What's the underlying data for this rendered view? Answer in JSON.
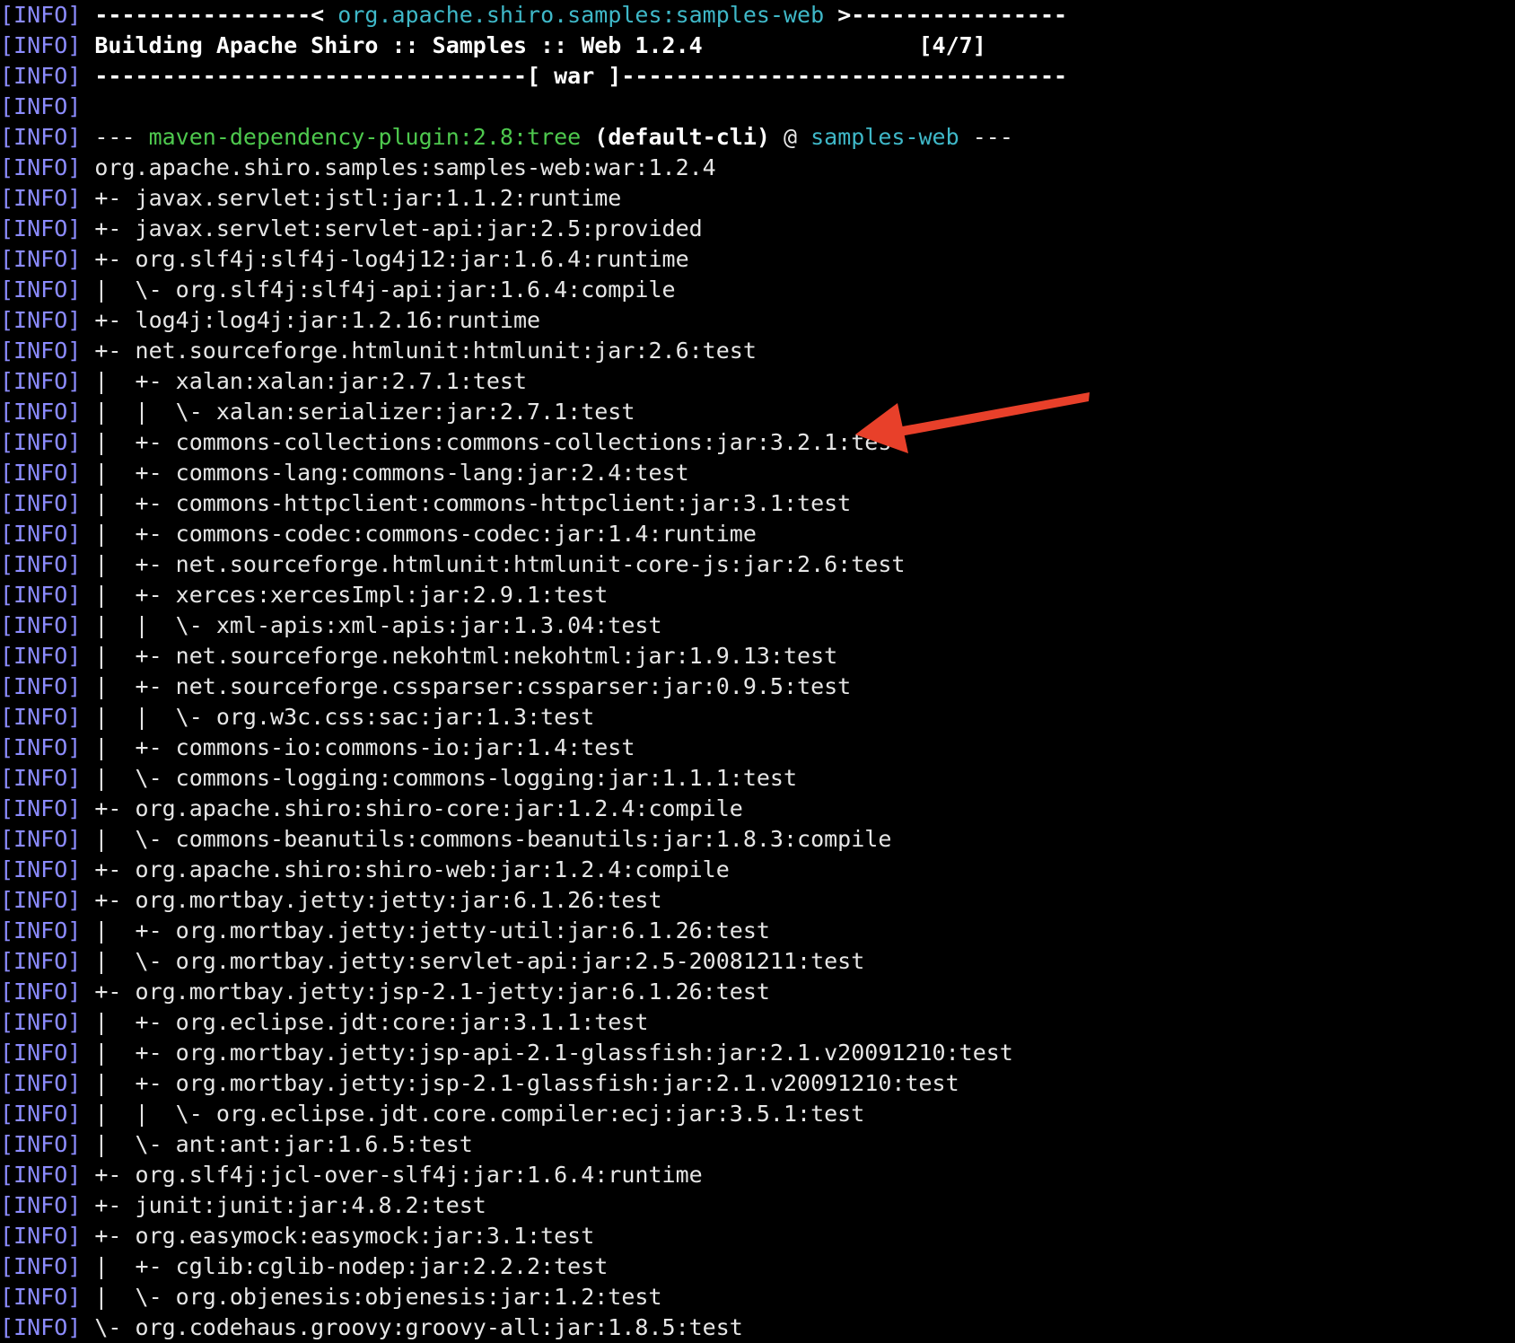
{
  "colors": {
    "background": "#000000",
    "text": "#e6e6e6",
    "info_tag": "#8c8cff",
    "green": "#4ec94e",
    "cyan": "#3fb8c8",
    "arrow": "#e8402a"
  },
  "icons": {
    "annotation": "red-arrow-icon"
  },
  "lines": [
    [
      {
        "t": "[INFO]",
        "c": "tag"
      },
      {
        "t": " ----------------< ",
        "c": "bold"
      },
      {
        "t": "org.apache.shiro.samples:samples-web",
        "c": "cyan"
      },
      {
        "t": " >----------------",
        "c": "bold"
      }
    ],
    [
      {
        "t": "[INFO]",
        "c": "tag"
      },
      {
        "t": " Building Apache Shiro :: Samples :: Web 1.2.4                [4/7]",
        "c": "bold"
      }
    ],
    [
      {
        "t": "[INFO]",
        "c": "tag"
      },
      {
        "t": " --------------------------------[ war ]---------------------------------",
        "c": "bold"
      }
    ],
    [
      {
        "t": "[INFO]",
        "c": "tag"
      }
    ],
    [
      {
        "t": "[INFO]",
        "c": "tag"
      },
      {
        "t": " --- "
      },
      {
        "t": "maven-dependency-plugin:2.8:tree",
        "c": "green"
      },
      {
        "t": " (default-cli)",
        "c": "bold"
      },
      {
        "t": " @ "
      },
      {
        "t": "samples-web",
        "c": "cyan"
      },
      {
        "t": " ---"
      }
    ],
    [
      {
        "t": "[INFO]",
        "c": "tag"
      },
      {
        "t": " org.apache.shiro.samples:samples-web:war:1.2.4"
      }
    ],
    [
      {
        "t": "[INFO]",
        "c": "tag"
      },
      {
        "t": " +- javax.servlet:jstl:jar:1.1.2:runtime"
      }
    ],
    [
      {
        "t": "[INFO]",
        "c": "tag"
      },
      {
        "t": " +- javax.servlet:servlet-api:jar:2.5:provided"
      }
    ],
    [
      {
        "t": "[INFO]",
        "c": "tag"
      },
      {
        "t": " +- org.slf4j:slf4j-log4j12:jar:1.6.4:runtime"
      }
    ],
    [
      {
        "t": "[INFO]",
        "c": "tag"
      },
      {
        "t": " |  \\- org.slf4j:slf4j-api:jar:1.6.4:compile"
      }
    ],
    [
      {
        "t": "[INFO]",
        "c": "tag"
      },
      {
        "t": " +- log4j:log4j:jar:1.2.16:runtime"
      }
    ],
    [
      {
        "t": "[INFO]",
        "c": "tag"
      },
      {
        "t": " +- net.sourceforge.htmlunit:htmlunit:jar:2.6:test"
      }
    ],
    [
      {
        "t": "[INFO]",
        "c": "tag"
      },
      {
        "t": " |  +- xalan:xalan:jar:2.7.1:test"
      }
    ],
    [
      {
        "t": "[INFO]",
        "c": "tag"
      },
      {
        "t": " |  |  \\- xalan:serializer:jar:2.7.1:test"
      }
    ],
    [
      {
        "t": "[INFO]",
        "c": "tag"
      },
      {
        "t": " |  +- commons-collections:commons-collections:jar:3.2.1:test"
      }
    ],
    [
      {
        "t": "[INFO]",
        "c": "tag"
      },
      {
        "t": " |  +- commons-lang:commons-lang:jar:2.4:test"
      }
    ],
    [
      {
        "t": "[INFO]",
        "c": "tag"
      },
      {
        "t": " |  +- commons-httpclient:commons-httpclient:jar:3.1:test"
      }
    ],
    [
      {
        "t": "[INFO]",
        "c": "tag"
      },
      {
        "t": " |  +- commons-codec:commons-codec:jar:1.4:runtime"
      }
    ],
    [
      {
        "t": "[INFO]",
        "c": "tag"
      },
      {
        "t": " |  +- net.sourceforge.htmlunit:htmlunit-core-js:jar:2.6:test"
      }
    ],
    [
      {
        "t": "[INFO]",
        "c": "tag"
      },
      {
        "t": " |  +- xerces:xercesImpl:jar:2.9.1:test"
      }
    ],
    [
      {
        "t": "[INFO]",
        "c": "tag"
      },
      {
        "t": " |  |  \\- xml-apis:xml-apis:jar:1.3.04:test"
      }
    ],
    [
      {
        "t": "[INFO]",
        "c": "tag"
      },
      {
        "t": " |  +- net.sourceforge.nekohtml:nekohtml:jar:1.9.13:test"
      }
    ],
    [
      {
        "t": "[INFO]",
        "c": "tag"
      },
      {
        "t": " |  +- net.sourceforge.cssparser:cssparser:jar:0.9.5:test"
      }
    ],
    [
      {
        "t": "[INFO]",
        "c": "tag"
      },
      {
        "t": " |  |  \\- org.w3c.css:sac:jar:1.3:test"
      }
    ],
    [
      {
        "t": "[INFO]",
        "c": "tag"
      },
      {
        "t": " |  +- commons-io:commons-io:jar:1.4:test"
      }
    ],
    [
      {
        "t": "[INFO]",
        "c": "tag"
      },
      {
        "t": " |  \\- commons-logging:commons-logging:jar:1.1.1:test"
      }
    ],
    [
      {
        "t": "[INFO]",
        "c": "tag"
      },
      {
        "t": " +- org.apache.shiro:shiro-core:jar:1.2.4:compile"
      }
    ],
    [
      {
        "t": "[INFO]",
        "c": "tag"
      },
      {
        "t": " |  \\- commons-beanutils:commons-beanutils:jar:1.8.3:compile"
      }
    ],
    [
      {
        "t": "[INFO]",
        "c": "tag"
      },
      {
        "t": " +- org.apache.shiro:shiro-web:jar:1.2.4:compile"
      }
    ],
    [
      {
        "t": "[INFO]",
        "c": "tag"
      },
      {
        "t": " +- org.mortbay.jetty:jetty:jar:6.1.26:test"
      }
    ],
    [
      {
        "t": "[INFO]",
        "c": "tag"
      },
      {
        "t": " |  +- org.mortbay.jetty:jetty-util:jar:6.1.26:test"
      }
    ],
    [
      {
        "t": "[INFO]",
        "c": "tag"
      },
      {
        "t": " |  \\- org.mortbay.jetty:servlet-api:jar:2.5-20081211:test"
      }
    ],
    [
      {
        "t": "[INFO]",
        "c": "tag"
      },
      {
        "t": " +- org.mortbay.jetty:jsp-2.1-jetty:jar:6.1.26:test"
      }
    ],
    [
      {
        "t": "[INFO]",
        "c": "tag"
      },
      {
        "t": " |  +- org.eclipse.jdt:core:jar:3.1.1:test"
      }
    ],
    [
      {
        "t": "[INFO]",
        "c": "tag"
      },
      {
        "t": " |  +- org.mortbay.jetty:jsp-api-2.1-glassfish:jar:2.1.v20091210:test"
      }
    ],
    [
      {
        "t": "[INFO]",
        "c": "tag"
      },
      {
        "t": " |  +- org.mortbay.jetty:jsp-2.1-glassfish:jar:2.1.v20091210:test"
      }
    ],
    [
      {
        "t": "[INFO]",
        "c": "tag"
      },
      {
        "t": " |  |  \\- org.eclipse.jdt.core.compiler:ecj:jar:3.5.1:test"
      }
    ],
    [
      {
        "t": "[INFO]",
        "c": "tag"
      },
      {
        "t": " |  \\- ant:ant:jar:1.6.5:test"
      }
    ],
    [
      {
        "t": "[INFO]",
        "c": "tag"
      },
      {
        "t": " +- org.slf4j:jcl-over-slf4j:jar:1.6.4:runtime"
      }
    ],
    [
      {
        "t": "[INFO]",
        "c": "tag"
      },
      {
        "t": " +- junit:junit:jar:4.8.2:test"
      }
    ],
    [
      {
        "t": "[INFO]",
        "c": "tag"
      },
      {
        "t": " +- org.easymock:easymock:jar:3.1:test"
      }
    ],
    [
      {
        "t": "[INFO]",
        "c": "tag"
      },
      {
        "t": " |  +- cglib:cglib-nodep:jar:2.2.2:test"
      }
    ],
    [
      {
        "t": "[INFO]",
        "c": "tag"
      },
      {
        "t": " |  \\- org.objenesis:objenesis:jar:1.2:test"
      }
    ],
    [
      {
        "t": "[INFO]",
        "c": "tag"
      },
      {
        "t": " \\- org.codehaus.groovy:groovy-all:jar:1.8.5:test"
      }
    ]
  ]
}
